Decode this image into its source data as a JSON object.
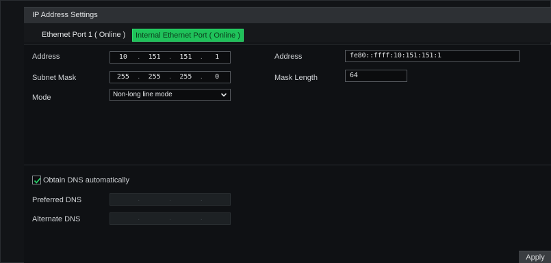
{
  "header": {
    "title": "IP Address Settings"
  },
  "tabs": [
    {
      "label": "Ethernet Port 1 ( Online )",
      "active": false
    },
    {
      "label": "Internal Ethernet Port ( Online )",
      "active": true
    }
  ],
  "ipv4": {
    "address_label": "Address",
    "address": [
      "10",
      "151",
      "151",
      "1"
    ],
    "subnet_label": "Subnet Mask",
    "subnet": [
      "255",
      "255",
      "255",
      "0"
    ],
    "mode_label": "Mode",
    "mode_value": "Non-long line mode"
  },
  "ipv6": {
    "address_label": "Address",
    "address_value": "fe80::ffff:10:151:151:1",
    "mask_label": "Mask Length",
    "mask_value": "64"
  },
  "dns": {
    "auto_label": "Obtain DNS automatically",
    "auto_checked": true,
    "preferred_label": "Preferred DNS",
    "preferred": [
      "",
      "",
      "",
      ""
    ],
    "alternate_label": "Alternate DNS",
    "alternate": [
      "",
      "",
      "",
      ""
    ]
  },
  "footer": {
    "apply_label": "Apply"
  },
  "colors": {
    "accent": "#1fc25a",
    "background": "#121417",
    "panel": "#2d3034"
  }
}
